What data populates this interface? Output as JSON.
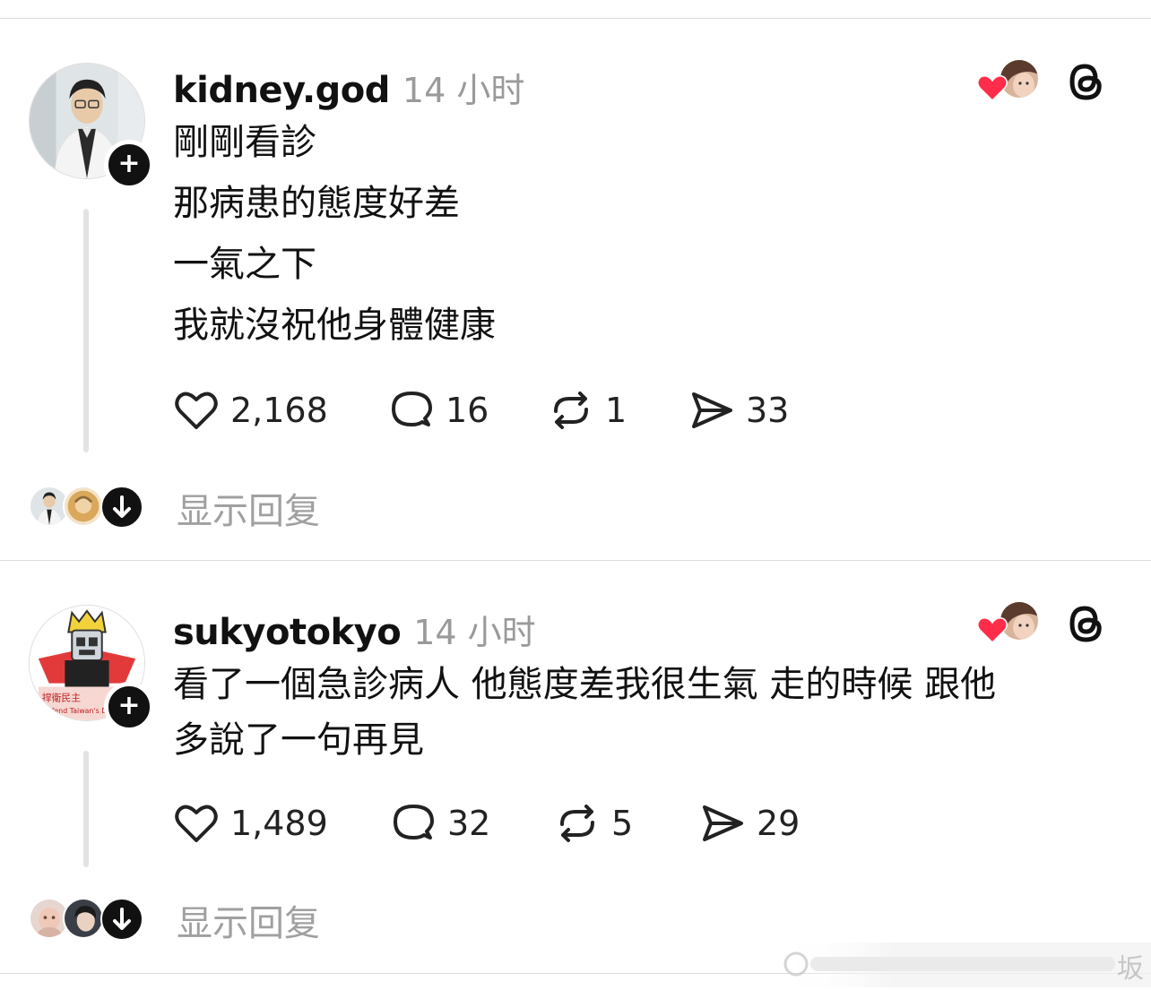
{
  "posts": [
    {
      "username": "kidney.god",
      "time": "14 小时",
      "lines": [
        "剛剛看診",
        "那病患的態度好差",
        "一氣之下",
        "我就沒祝他身體健康"
      ],
      "likes": "2,168",
      "comments": "16",
      "reposts": "1",
      "shares": "33",
      "show_replies": "显示回复"
    },
    {
      "username": "sukyotokyo",
      "time": "14 小时",
      "lines": [
        "看了一個急診病人 他態度差我很生氣 走的時候 跟他",
        "多說了一句再見"
      ],
      "likes": "1,489",
      "comments": "32",
      "reposts": "5",
      "shares": "29",
      "show_replies": "显示回复"
    }
  ],
  "icons": {
    "like": "heart-outline-icon",
    "comment": "speech-bubble-icon",
    "repost": "repost-arrows-icon",
    "share": "paper-plane-icon",
    "app": "threads-logo-icon",
    "liked": "red-heart-icon",
    "follow": "plus-icon",
    "expand": "arrow-down-icon"
  },
  "colors": {
    "heart": "#ff2d4a",
    "muted": "#9a9a9a",
    "text": "#111111"
  },
  "watermark": {
    "text": "坂"
  }
}
